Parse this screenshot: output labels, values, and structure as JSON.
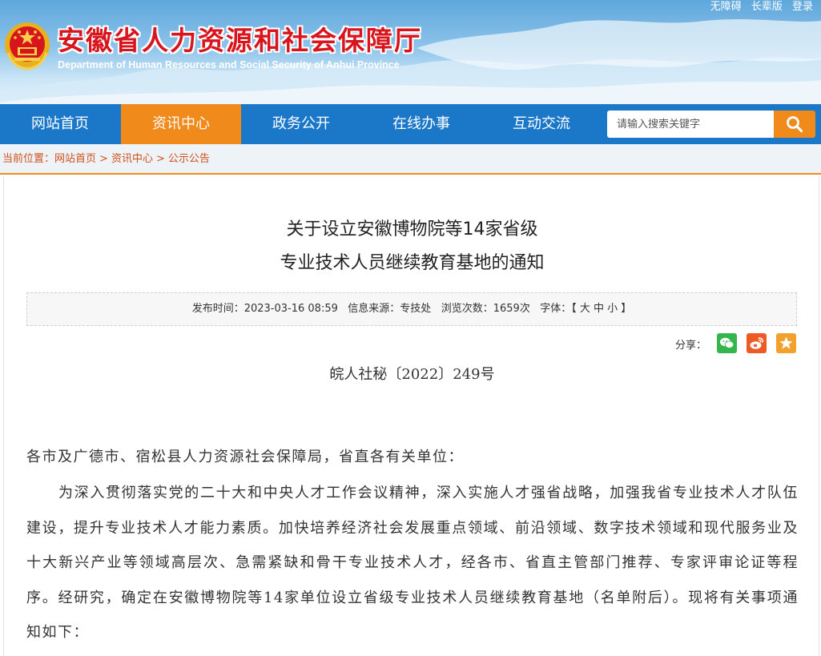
{
  "header": {
    "top_links": [
      "无障碍",
      "长辈版",
      "登录"
    ],
    "title": "安徽省人力资源和社会保障厅",
    "subtitle": "Department of Human Resources and Social Security of Anhui Province"
  },
  "nav": {
    "items": [
      {
        "label": "网站首页",
        "active": false
      },
      {
        "label": "资讯中心",
        "active": true
      },
      {
        "label": "政务公开",
        "active": false
      },
      {
        "label": "在线办事",
        "active": false
      },
      {
        "label": "互动交流",
        "active": false
      }
    ],
    "search": {
      "placeholder": "请输入搜索关键字",
      "icon": "search-icon"
    }
  },
  "breadcrumb": {
    "prefix": "当前位置：",
    "items": [
      "网站首页",
      "资讯中心",
      "公示公告"
    ],
    "separator": ">"
  },
  "article": {
    "title_line1": "关于设立安徽博物院等14家省级",
    "title_line2": "专业技术人员继续教育基地的通知",
    "meta": {
      "publish_label": "发布时间：",
      "publish_time": "2023-03-16 08:59",
      "source_label": "信息来源：",
      "source": "专技处",
      "views_label": "浏览次数：",
      "views": "1659次",
      "font_label": "字体：",
      "font_sizes": "【 大 中 小 】"
    },
    "share": {
      "label": "分享：",
      "buttons": [
        {
          "name": "wechat",
          "icon": "wechat-icon",
          "color": "#35b64c"
        },
        {
          "name": "weibo",
          "icon": "weibo-icon",
          "color": "#ee5a24"
        },
        {
          "name": "favorite",
          "icon": "star-icon",
          "color": "#f1a12c"
        }
      ]
    },
    "doc_number": "皖人社秘〔2022〕249号",
    "salutation": "各市及广德市、宿松县人力资源社会保障局，省直各有关单位：",
    "paragraph1": "为深入贯彻落实党的二十大和中央人才工作会议精神，深入实施人才强省战略，加强我省专业技术人才队伍建设，提升专业技术人才能力素质。加快培养经济社会发展重点领域、前沿领域、数字技术领域和现代服务业及十大新兴产业等领域高层次、急需紧缺和骨干专业技术人才，经各市、省直主管部门推荐、专家评审论证等程序。经研究，确定在安徽博物院等14家单位设立省级专业技术人员继续教育基地（名单附后）。现将有关事项通知如下："
  },
  "colors": {
    "nav_bg": "#1b78c9",
    "accent": "#f08a1b",
    "title_red": "#d8141c",
    "breadcrumb_text": "#d0501b"
  }
}
